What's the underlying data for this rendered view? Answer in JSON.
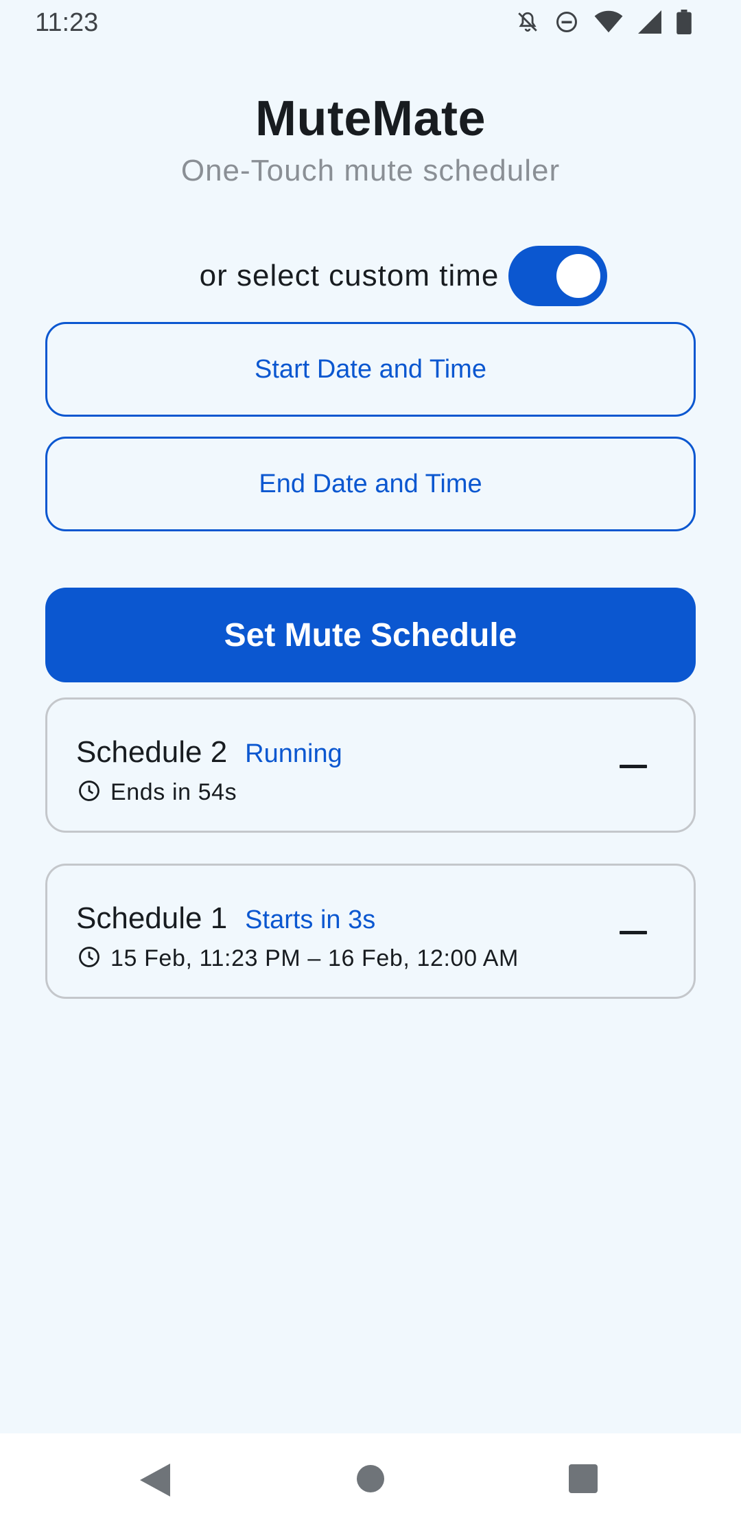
{
  "status_bar": {
    "time": "11:23",
    "icons": [
      "bell-off-icon",
      "do-not-disturb-icon",
      "wifi-icon",
      "signal-icon",
      "battery-icon"
    ]
  },
  "header": {
    "title": "MuteMate",
    "subtitle": "One-Touch mute scheduler"
  },
  "custom_time": {
    "label": "or select custom time",
    "toggle_on": true
  },
  "buttons": {
    "start_label": "Start Date and Time",
    "end_label": "End Date and Time",
    "set_label": "Set Mute Schedule"
  },
  "schedules": [
    {
      "title": "Schedule 2",
      "status": "Running",
      "detail": "Ends in 54s",
      "icon": "clock-icon"
    },
    {
      "title": "Schedule 1",
      "status": "Starts in 3s",
      "detail": "15 Feb, 11:23 PM – 16 Feb, 12:00 AM",
      "icon": "clock-icon"
    }
  ],
  "colors": {
    "accent": "#0b57d0",
    "background": "#f1f8fd",
    "text": "#181c20",
    "muted": "#8a8f95"
  },
  "nav": {
    "icons": [
      "back-icon",
      "home-icon",
      "recents-icon"
    ]
  }
}
